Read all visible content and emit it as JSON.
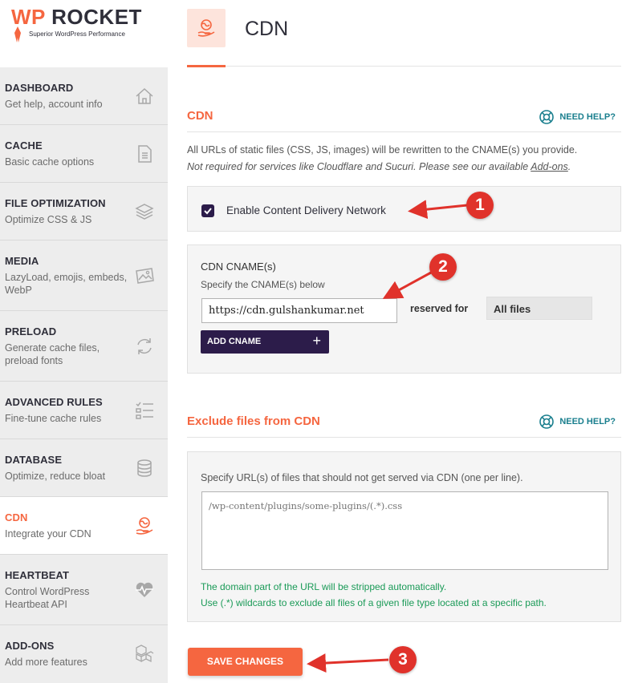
{
  "brand": {
    "name_prefix": "WP",
    "name_rest": " ROCKET",
    "tagline": "Superior WordPress Performance"
  },
  "sidebar": {
    "items": [
      {
        "title": "DASHBOARD",
        "sub": "Get help, account info",
        "icon": "home-icon"
      },
      {
        "title": "CACHE",
        "sub": "Basic cache options",
        "icon": "file-icon"
      },
      {
        "title": "FILE OPTIMIZATION",
        "sub": "Optimize CSS & JS",
        "icon": "layers-icon"
      },
      {
        "title": "MEDIA",
        "sub": "LazyLoad, emojis, embeds, WebP",
        "icon": "image-icon"
      },
      {
        "title": "PRELOAD",
        "sub": "Generate cache files, preload fonts",
        "icon": "refresh-icon"
      },
      {
        "title": "ADVANCED RULES",
        "sub": "Fine-tune cache rules",
        "icon": "checklist-icon"
      },
      {
        "title": "DATABASE",
        "sub": "Optimize, reduce bloat",
        "icon": "database-icon"
      },
      {
        "title": "CDN",
        "sub": "Integrate your CDN",
        "icon": "cdn-globe-hand-icon",
        "active": true
      },
      {
        "title": "HEARTBEAT",
        "sub": "Control WordPress Heartbeat API",
        "icon": "heartbeat-icon"
      },
      {
        "title": "ADD-ONS",
        "sub": "Add more features",
        "icon": "cubes-icon"
      }
    ]
  },
  "header": {
    "title": "CDN"
  },
  "cdn_section": {
    "title": "CDN",
    "help": "NEED HELP?",
    "desc_line1": "All URLs of static files (CSS, JS, images) will be rewritten to the CNAME(s) you provide.",
    "desc_note": "Not required for services like Cloudflare and Sucuri. Please see our available ",
    "desc_link": "Add-ons",
    "desc_end": "."
  },
  "enable": {
    "label": "Enable Content Delivery Network",
    "checked": true
  },
  "cname": {
    "title": "CDN CNAME(s)",
    "help": "Specify the CNAME(s) below",
    "value": "https://cdn.gulshankumar.net",
    "reserved_label": "reserved for",
    "reserved_value": "All files",
    "add_button": "ADD CNAME",
    "add_plus": "+"
  },
  "exclude": {
    "title": "Exclude files from CDN",
    "help": "NEED HELP?",
    "instructions": "Specify URL(s) of files that should not get served via CDN (one per line).",
    "placeholder": "/wp-content/plugins/some-plugins/(.*).css",
    "note1": "The domain part of the URL will be stripped automatically.",
    "note2": "Use (.*) wildcards to exclude all files of a given file type located at a specific path."
  },
  "save_button": "SAVE CHANGES",
  "markers": [
    "1",
    "2",
    "3"
  ],
  "colors": {
    "accent": "#f56640",
    "dark": "#2c1c4a",
    "help": "#1a7f8e",
    "green": "#1a9a57",
    "marker": "#e0322b"
  }
}
